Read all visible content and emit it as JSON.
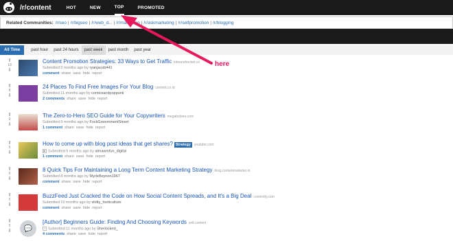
{
  "header": {
    "subreddit": "/r/content",
    "tabs": [
      "HOT",
      "NEW",
      "TOP",
      "PROMOTED"
    ],
    "active_tab": "TOP"
  },
  "related": {
    "label": "Related Communities:",
    "links": [
      "/r/seo",
      "/r/bigseo",
      "/r/web_d...",
      "/r/marketing",
      "/r/askmarketing",
      "/r/selfpromotion",
      "/r/blogging"
    ]
  },
  "timefilter": {
    "tabs": [
      "All Time",
      "past hour",
      "past 24 hours",
      "past week",
      "past month",
      "past year"
    ]
  },
  "annotation": {
    "text": "here",
    "color": "#e8195a"
  },
  "actions": {
    "share": "share",
    "save": "save",
    "hide": "hide",
    "report": "report"
  },
  "posts": [
    {
      "score": "18",
      "title": "Content Promotion Strategies: 33 Ways to Get Traffic",
      "domain": "inboundrocket.co",
      "flair": "",
      "meta_prefix": "Submitted 9 months ago by",
      "user": "ryanjacob441",
      "comments": "comment",
      "thumb_color": "#3d5a80"
    },
    {
      "score": "8",
      "title": "24 Places To Find Free Images For Your Blog",
      "domain": "content.co.id",
      "flair": "",
      "meta_prefix": "Submitted 11 months ago by",
      "user": "comicsandpoppunk",
      "comments": "2 comments",
      "thumb_color": "#7a3fa0"
    },
    {
      "score": "9",
      "title": "The Zero-to-Hero SEO Guide for Your Copywriters",
      "domain": "megabotseo.com",
      "flair": "",
      "meta_prefix": "Submitted 9 months ago by",
      "user": "FuckGovernmentStreet",
      "comments": "1 comment",
      "thumb_color": "#c44a4a"
    },
    {
      "score": "5",
      "title": "How to come up with blog post ideas that get shares?",
      "domain": "youtube.com",
      "flair": "Strategy",
      "meta_prefix": "Submitted 9 months ago by",
      "user": "almawmfun_digital",
      "comments": "1 comment",
      "thumb_color": "#d9b14a"
    },
    {
      "score": "6",
      "title": "8 Quick Tips For Maintaining a Long Term Content Marketing Strategy",
      "domain": "blog.contentmarketer.io",
      "flair": "",
      "meta_prefix": "Submitted 8 months ago by",
      "user": "MyrleBeynon1967",
      "comments": "comment",
      "thumb_color": "#8a3a2a"
    },
    {
      "score": "5",
      "title": "BuzzFeed Just Cracked the Code on How Social Content Spreads, and It's a Big Deal",
      "domain": "contently.com",
      "flair": "",
      "meta_prefix": "Submitted 10 months ago by",
      "user": "shitty_horticulture",
      "comments": "comment",
      "thumb_color": "#d43a3a"
    },
    {
      "score": "5",
      "title": "[Author] Beginners Guide: Finding And Choosing Keywords",
      "domain": "self.content",
      "flair": "",
      "meta_prefix": "Submitted 11 months ago by",
      "user": "Sherlocked_",
      "comments": "4 comments",
      "thumb_color": "#d0d4d8"
    }
  ]
}
